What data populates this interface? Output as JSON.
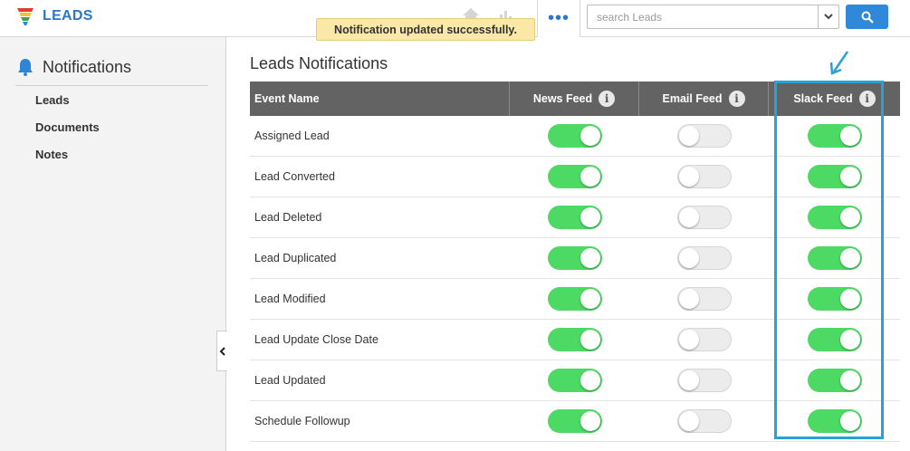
{
  "app": {
    "title": "LEADS"
  },
  "header": {
    "more_label": "•••",
    "search": {
      "placeholder": "search Leads",
      "value": ""
    }
  },
  "toast": {
    "message": "Notification updated successfully."
  },
  "sidebar": {
    "title": "Notifications",
    "items": [
      {
        "label": "Leads"
      },
      {
        "label": "Documents"
      },
      {
        "label": "Notes"
      }
    ]
  },
  "main": {
    "title": "Leads Notifications",
    "columns": {
      "event": "Event Name",
      "news": "News Feed",
      "email": "Email Feed",
      "slack": "Slack Feed"
    },
    "rows": [
      {
        "event": "Assigned Lead",
        "news": true,
        "email": false,
        "slack": true
      },
      {
        "event": "Lead Converted",
        "news": true,
        "email": false,
        "slack": true
      },
      {
        "event": "Lead Deleted",
        "news": true,
        "email": false,
        "slack": true
      },
      {
        "event": "Lead Duplicated",
        "news": true,
        "email": false,
        "slack": true
      },
      {
        "event": "Lead Modified",
        "news": true,
        "email": false,
        "slack": true
      },
      {
        "event": "Lead Update Close Date",
        "news": true,
        "email": false,
        "slack": true
      },
      {
        "event": "Lead Updated",
        "news": true,
        "email": false,
        "slack": true
      },
      {
        "event": "Schedule Followup",
        "news": true,
        "email": false,
        "slack": true
      }
    ]
  },
  "colors": {
    "brand": "#2e74c8",
    "toggle_on": "#4cd964",
    "highlight": "#2aa0d8",
    "header_bg": "#636363",
    "toast_bg": "#fbe8a6"
  }
}
